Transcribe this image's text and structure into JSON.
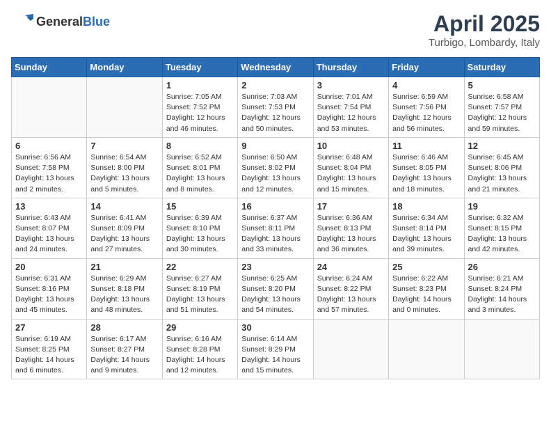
{
  "header": {
    "logo_general": "General",
    "logo_blue": "Blue",
    "month": "April 2025",
    "location": "Turbigo, Lombardy, Italy"
  },
  "weekdays": [
    "Sunday",
    "Monday",
    "Tuesday",
    "Wednesday",
    "Thursday",
    "Friday",
    "Saturday"
  ],
  "weeks": [
    [
      {
        "day": "",
        "info": ""
      },
      {
        "day": "",
        "info": ""
      },
      {
        "day": "1",
        "info": "Sunrise: 7:05 AM\nSunset: 7:52 PM\nDaylight: 12 hours and 46 minutes."
      },
      {
        "day": "2",
        "info": "Sunrise: 7:03 AM\nSunset: 7:53 PM\nDaylight: 12 hours and 50 minutes."
      },
      {
        "day": "3",
        "info": "Sunrise: 7:01 AM\nSunset: 7:54 PM\nDaylight: 12 hours and 53 minutes."
      },
      {
        "day": "4",
        "info": "Sunrise: 6:59 AM\nSunset: 7:56 PM\nDaylight: 12 hours and 56 minutes."
      },
      {
        "day": "5",
        "info": "Sunrise: 6:58 AM\nSunset: 7:57 PM\nDaylight: 12 hours and 59 minutes."
      }
    ],
    [
      {
        "day": "6",
        "info": "Sunrise: 6:56 AM\nSunset: 7:58 PM\nDaylight: 13 hours and 2 minutes."
      },
      {
        "day": "7",
        "info": "Sunrise: 6:54 AM\nSunset: 8:00 PM\nDaylight: 13 hours and 5 minutes."
      },
      {
        "day": "8",
        "info": "Sunrise: 6:52 AM\nSunset: 8:01 PM\nDaylight: 13 hours and 8 minutes."
      },
      {
        "day": "9",
        "info": "Sunrise: 6:50 AM\nSunset: 8:02 PM\nDaylight: 13 hours and 12 minutes."
      },
      {
        "day": "10",
        "info": "Sunrise: 6:48 AM\nSunset: 8:04 PM\nDaylight: 13 hours and 15 minutes."
      },
      {
        "day": "11",
        "info": "Sunrise: 6:46 AM\nSunset: 8:05 PM\nDaylight: 13 hours and 18 minutes."
      },
      {
        "day": "12",
        "info": "Sunrise: 6:45 AM\nSunset: 8:06 PM\nDaylight: 13 hours and 21 minutes."
      }
    ],
    [
      {
        "day": "13",
        "info": "Sunrise: 6:43 AM\nSunset: 8:07 PM\nDaylight: 13 hours and 24 minutes."
      },
      {
        "day": "14",
        "info": "Sunrise: 6:41 AM\nSunset: 8:09 PM\nDaylight: 13 hours and 27 minutes."
      },
      {
        "day": "15",
        "info": "Sunrise: 6:39 AM\nSunset: 8:10 PM\nDaylight: 13 hours and 30 minutes."
      },
      {
        "day": "16",
        "info": "Sunrise: 6:37 AM\nSunset: 8:11 PM\nDaylight: 13 hours and 33 minutes."
      },
      {
        "day": "17",
        "info": "Sunrise: 6:36 AM\nSunset: 8:13 PM\nDaylight: 13 hours and 36 minutes."
      },
      {
        "day": "18",
        "info": "Sunrise: 6:34 AM\nSunset: 8:14 PM\nDaylight: 13 hours and 39 minutes."
      },
      {
        "day": "19",
        "info": "Sunrise: 6:32 AM\nSunset: 8:15 PM\nDaylight: 13 hours and 42 minutes."
      }
    ],
    [
      {
        "day": "20",
        "info": "Sunrise: 6:31 AM\nSunset: 8:16 PM\nDaylight: 13 hours and 45 minutes."
      },
      {
        "day": "21",
        "info": "Sunrise: 6:29 AM\nSunset: 8:18 PM\nDaylight: 13 hours and 48 minutes."
      },
      {
        "day": "22",
        "info": "Sunrise: 6:27 AM\nSunset: 8:19 PM\nDaylight: 13 hours and 51 minutes."
      },
      {
        "day": "23",
        "info": "Sunrise: 6:25 AM\nSunset: 8:20 PM\nDaylight: 13 hours and 54 minutes."
      },
      {
        "day": "24",
        "info": "Sunrise: 6:24 AM\nSunset: 8:22 PM\nDaylight: 13 hours and 57 minutes."
      },
      {
        "day": "25",
        "info": "Sunrise: 6:22 AM\nSunset: 8:23 PM\nDaylight: 14 hours and 0 minutes."
      },
      {
        "day": "26",
        "info": "Sunrise: 6:21 AM\nSunset: 8:24 PM\nDaylight: 14 hours and 3 minutes."
      }
    ],
    [
      {
        "day": "27",
        "info": "Sunrise: 6:19 AM\nSunset: 8:25 PM\nDaylight: 14 hours and 6 minutes."
      },
      {
        "day": "28",
        "info": "Sunrise: 6:17 AM\nSunset: 8:27 PM\nDaylight: 14 hours and 9 minutes."
      },
      {
        "day": "29",
        "info": "Sunrise: 6:16 AM\nSunset: 8:28 PM\nDaylight: 14 hours and 12 minutes."
      },
      {
        "day": "30",
        "info": "Sunrise: 6:14 AM\nSunset: 8:29 PM\nDaylight: 14 hours and 15 minutes."
      },
      {
        "day": "",
        "info": ""
      },
      {
        "day": "",
        "info": ""
      },
      {
        "day": "",
        "info": ""
      }
    ]
  ]
}
